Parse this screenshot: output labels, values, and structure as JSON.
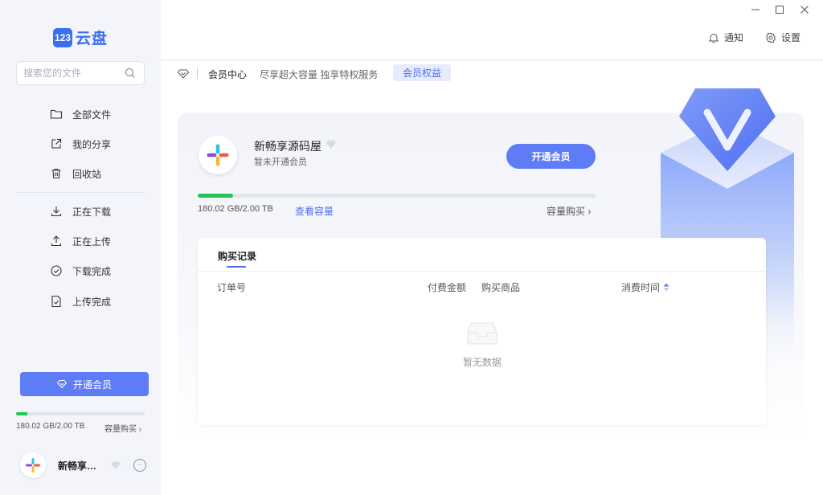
{
  "logo": {
    "badge": "123",
    "text": "云盘"
  },
  "search": {
    "placeholder": "搜索您的文件"
  },
  "sidebar": {
    "items": [
      {
        "label": "全部文件",
        "icon": "folder-icon"
      },
      {
        "label": "我的分享",
        "icon": "share-icon"
      },
      {
        "label": "回收站",
        "icon": "trash-icon"
      },
      {
        "label": "正在下载",
        "icon": "download-icon"
      },
      {
        "label": "正在上传",
        "icon": "upload-icon"
      },
      {
        "label": "下载完成",
        "icon": "check-icon"
      },
      {
        "label": "上传完成",
        "icon": "file-check-icon"
      }
    ],
    "vip_button": "开通会员",
    "storage_text": "180.02 GB/2.00 TB",
    "storage_fraction": 0.088,
    "buy_label": "容量购买",
    "user_name": "新畅享源码屋"
  },
  "topbar": {
    "notify_label": "通知",
    "settings_label": "设置"
  },
  "breadcrumb": {
    "title": "会员中心",
    "subtitle": "尽享超大容量 独享特权服务",
    "tag": "会员权益"
  },
  "profile": {
    "name": "新畅享源码屋",
    "status": "暂未开通会员",
    "open_button": "开通会员",
    "storage_text": "180.02 GB/2.00 TB",
    "storage_fraction": 0.088,
    "view_capacity": "查看容量",
    "buy_capacity": "容量购买"
  },
  "records": {
    "tab": "购买记录",
    "columns": [
      "订单号",
      "付费金额",
      "购买商品",
      "消费时间"
    ],
    "empty_text": "暂无数据"
  },
  "colors": {
    "accent": "#5d7cf5",
    "brand": "#3b6ef0",
    "progress": "#24c557"
  }
}
